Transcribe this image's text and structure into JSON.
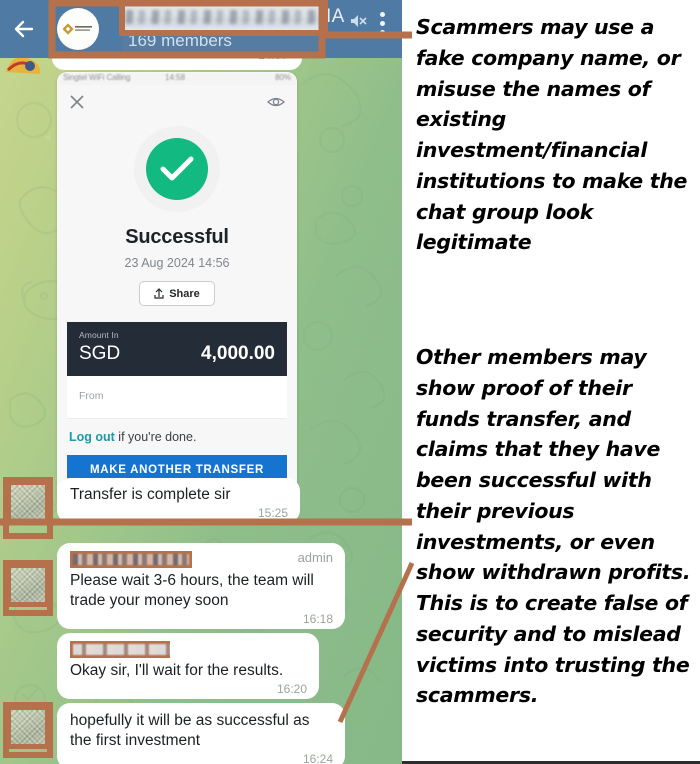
{
  "header": {
    "back_icon": "back-arrow-icon",
    "group_name_visible_tail": "IA",
    "group_name_redacted": true,
    "members": "169 members",
    "mute_icon": "muted-speaker-icon",
    "menu_icon": "overflow-menu-icon",
    "avatar_icon": "group-avatar-logo"
  },
  "partial_bubble": {
    "time": "14:57"
  },
  "receipt": {
    "statusbar": {
      "carrier": "Singtel WiFi Calling",
      "clock": "14:58",
      "battery": "80%"
    },
    "close_icon": "close-icon",
    "eye_icon": "eye-icon",
    "check_icon": "check-circle-icon",
    "title": "Successful",
    "datetime": "23 Aug 2024 14:56",
    "share_label": "Share",
    "share_icon": "share-icon",
    "amount_label": "Amount In",
    "currency": "SGD",
    "amount": "4,000.00",
    "from_label": "From",
    "logout_link": "Log out",
    "logout_rest": " if you're done.",
    "transfer_again_label": "MAKE ANOTHER TRANSFER",
    "colors": {
      "success_green": "#12b981",
      "amount_panel": "#242c38",
      "primary_button": "#1574d0"
    }
  },
  "messages": [
    {
      "sender_redacted": true,
      "text": "Transfer is complete sir",
      "time": "15:25",
      "role": "",
      "has_avatar": true
    },
    {
      "sender_redacted": true,
      "text": "Please wait 3-6 hours, the team will trade your money soon",
      "time": "16:18",
      "role": "admin",
      "has_avatar": true
    },
    {
      "sender_redacted": true,
      "text": "Okay sir, I'll wait for the results.",
      "time": "16:20",
      "role": "",
      "has_avatar": false
    },
    {
      "sender_redacted": true,
      "text": "hopefully it will be as successful as the first investment",
      "time": "16:24",
      "role": "",
      "has_avatar": true
    }
  ],
  "annotations": [
    {
      "id": "annotation-group-name",
      "text": "Scammers may use a fake company name, or misuse the names of existing investment/financial institutions to make the chat group look legitimate"
    },
    {
      "id": "annotation-proof-of-transfer",
      "text": "Other members may show proof of their funds transfer, and claims that they have been successful with their previous investments, or even show withdrawn profits. This is to create false of security and to mislead victims into trusting the scammers."
    }
  ],
  "colors": {
    "header_blue": "#4e7aa4",
    "annotation_orange": "#b4714c",
    "chat_green": "#8fbe8a",
    "chat_yellow_green": "#c9d78f"
  }
}
